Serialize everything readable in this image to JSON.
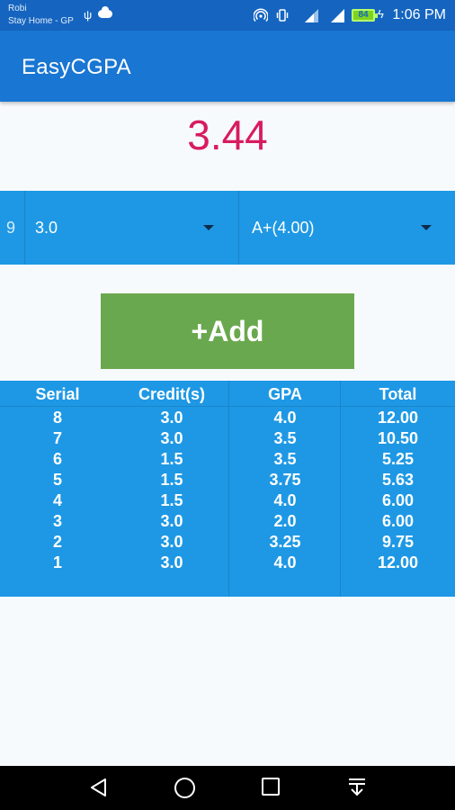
{
  "status_bar": {
    "carrier_line1": "Robi",
    "carrier_line2": "Stay Home - GP",
    "battery_level": "84",
    "time": "1:06 PM",
    "icons": [
      "usb-icon",
      "cloud-icon",
      "hotspot-icon",
      "vibrate-icon",
      "signal-icon",
      "signal-icon",
      "battery-icon",
      "charging-icon"
    ]
  },
  "app_bar": {
    "title": "EasyCGPA"
  },
  "cgpa": {
    "value": "3.44"
  },
  "selector": {
    "next_serial": "9",
    "credit_value": "3.0",
    "grade_value": "A+(4.00)"
  },
  "add_button": {
    "label": "+Add"
  },
  "table": {
    "headers": [
      "Serial",
      "Credit(s)",
      "GPA",
      "Total"
    ],
    "rows": [
      [
        "8",
        "3.0",
        "4.0",
        "12.00"
      ],
      [
        "7",
        "3.0",
        "3.5",
        "10.50"
      ],
      [
        "6",
        "1.5",
        "3.5",
        "5.25"
      ],
      [
        "5",
        "1.5",
        "3.75",
        "5.63"
      ],
      [
        "4",
        "1.5",
        "4.0",
        "6.00"
      ],
      [
        "3",
        "3.0",
        "2.0",
        "6.00"
      ],
      [
        "2",
        "3.0",
        "3.25",
        "9.75"
      ],
      [
        "1",
        "3.0",
        "4.0",
        "12.00"
      ]
    ]
  },
  "nav_bar": {
    "icons": [
      "back-icon",
      "home-icon",
      "recents-icon",
      "notifications-pull-icon"
    ]
  },
  "colors": {
    "status_bar": "#1565c0",
    "app_bar": "#1976d2",
    "cgpa_text": "#d81b60",
    "panel_blue": "#1e98e4",
    "add_button": "#6aa84f"
  }
}
